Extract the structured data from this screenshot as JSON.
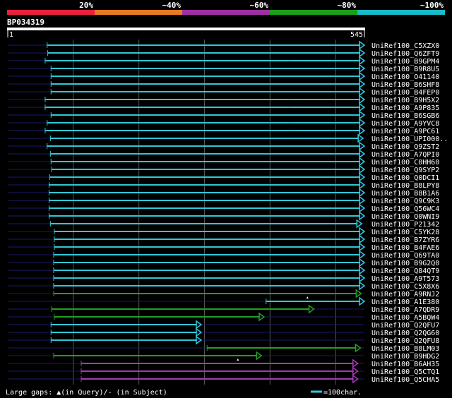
{
  "legend": {
    "labels": [
      "20%",
      "~40%",
      "~60%",
      "~80%",
      "~100%"
    ],
    "colors": [
      "#e8213c",
      "#e87a21",
      "#9e2fa3",
      "#18a018",
      "#18bcc8"
    ]
  },
  "query": {
    "id": "BP034319",
    "start_label": "1",
    "end_label": "545",
    "length": 545
  },
  "colors": {
    "background": "#000000",
    "grid": "#555555",
    "query_bar": "#ffffff",
    "query_line": "#1a1a6a"
  },
  "hits": [
    {
      "name": "UniRef100_C5XZX0",
      "start": 61,
      "end": 545,
      "color": "cyan",
      "arrow": true
    },
    {
      "name": "UniRef100_Q6ZFT9",
      "start": 62,
      "end": 545,
      "color": "cyan",
      "arrow": true
    },
    {
      "name": "UniRef100_B9GPM4",
      "start": 58,
      "end": 545,
      "color": "cyan",
      "arrow": true,
      "gap_tick": 430
    },
    {
      "name": "UniRef100_B9R8U5",
      "start": 67,
      "end": 545,
      "color": "cyan",
      "arrow": true
    },
    {
      "name": "UniRef100_O41140",
      "start": 67,
      "end": 545,
      "color": "cyan",
      "arrow": true
    },
    {
      "name": "UniRef100_B6SHF8",
      "start": 67,
      "end": 545,
      "color": "cyan",
      "arrow": true
    },
    {
      "name": "UniRef100_B4FEP0",
      "start": 67,
      "end": 545,
      "color": "cyan",
      "arrow": true
    },
    {
      "name": "UniRef100_B9H5X2",
      "start": 58,
      "end": 545,
      "color": "cyan",
      "arrow": true,
      "gap_tick": 430
    },
    {
      "name": "UniRef100_A9P835",
      "start": 58,
      "end": 545,
      "color": "cyan",
      "arrow": true,
      "gap_tick": 430
    },
    {
      "name": "UniRef100_B6SGB6",
      "start": 67,
      "end": 545,
      "color": "cyan",
      "arrow": true
    },
    {
      "name": "UniRef100_A9YVC8",
      "start": 61,
      "end": 545,
      "color": "cyan",
      "arrow": true,
      "gap_tick": 430
    },
    {
      "name": "UniRef100_A9PC61",
      "start": 58,
      "end": 545,
      "color": "cyan",
      "arrow": true,
      "gap_tick": 430
    },
    {
      "name": "UniRef100_UPI000..",
      "start": 66,
      "end": 543,
      "color": "cyan",
      "arrow": true
    },
    {
      "name": "UniRef100_Q9ZST2",
      "start": 61,
      "end": 545,
      "color": "cyan",
      "arrow": true
    },
    {
      "name": "UniRef100_A7QPI0",
      "start": 66,
      "end": 545,
      "color": "cyan",
      "arrow": true
    },
    {
      "name": "UniRef100_C0HH60",
      "start": 67,
      "end": 545,
      "color": "cyan",
      "arrow": true
    },
    {
      "name": "UniRef100_Q9SYP2",
      "start": 68,
      "end": 545,
      "color": "cyan",
      "arrow": true
    },
    {
      "name": "UniRef100_Q0DCI1",
      "start": 65,
      "end": 545,
      "color": "cyan",
      "arrow": true
    },
    {
      "name": "UniRef100_B8LPY8",
      "start": 64,
      "end": 545,
      "color": "cyan",
      "arrow": true
    },
    {
      "name": "UniRef100_B8B1A6",
      "start": 64,
      "end": 545,
      "color": "cyan",
      "arrow": true
    },
    {
      "name": "UniRef100_Q9C9K3",
      "start": 64,
      "end": 545,
      "color": "cyan",
      "arrow": true
    },
    {
      "name": "UniRef100_Q56WC4",
      "start": 64,
      "end": 545,
      "color": "cyan",
      "arrow": true
    },
    {
      "name": "UniRef100_Q0WNI9",
      "start": 64,
      "end": 545,
      "color": "cyan",
      "arrow": true
    },
    {
      "name": "UniRef100_P21342",
      "start": 66,
      "end": 541,
      "color": "cyan",
      "arrow": true
    },
    {
      "name": "UniRef100_C5YK28",
      "start": 72,
      "end": 545,
      "color": "cyan",
      "arrow": true
    },
    {
      "name": "UniRef100_B7ZYR6",
      "start": 72,
      "end": 545,
      "color": "cyan",
      "arrow": true
    },
    {
      "name": "UniRef100_B4FAE6",
      "start": 72,
      "end": 545,
      "color": "cyan",
      "arrow": true
    },
    {
      "name": "UniRef100_Q69TA0",
      "start": 71,
      "end": 545,
      "color": "cyan",
      "arrow": true
    },
    {
      "name": "UniRef100_B9G2Q0",
      "start": 71,
      "end": 545,
      "color": "cyan",
      "arrow": true
    },
    {
      "name": "UniRef100_Q84QT9",
      "start": 71,
      "end": 545,
      "color": "cyan",
      "arrow": true
    },
    {
      "name": "UniRef100_A9T573",
      "start": 71,
      "end": 545,
      "color": "cyan",
      "arrow": true
    },
    {
      "name": "UniRef100_C5X8X6",
      "start": 71,
      "end": 545,
      "color": "cyan",
      "arrow": true
    },
    {
      "name": "UniRef100_A9RNJ2",
      "start": 71,
      "end": 540,
      "color": "green",
      "arrow": true,
      "gap_mark": 458
    },
    {
      "name": "UniRef100_A1E380",
      "start": 395,
      "end": 545,
      "color": "cyan",
      "arrow": true
    },
    {
      "name": "UniRef100_A7QDR9",
      "start": 68,
      "end": 468,
      "color": "green",
      "arrow": true
    },
    {
      "name": "UniRef100_A5BQW4",
      "start": 72,
      "end": 392,
      "color": "green",
      "arrow": true
    },
    {
      "name": "UniRef100_Q2QFU7",
      "start": 67,
      "end": 296,
      "color": "cyan",
      "arrow": true
    },
    {
      "name": "UniRef100_Q2QG60",
      "start": 67,
      "end": 296,
      "color": "cyan",
      "arrow": true
    },
    {
      "name": "UniRef100_Q2QFU8",
      "start": 67,
      "end": 296,
      "color": "cyan",
      "arrow": true
    },
    {
      "name": "UniRef100_B8LM03",
      "start": 305,
      "end": 539,
      "color": "green",
      "arrow": true
    },
    {
      "name": "UniRef100_B9HDG2",
      "start": 71,
      "end": 388,
      "color": "green",
      "arrow": true,
      "gap_mark": 352
    },
    {
      "name": "UniRef100_B6AH35",
      "start": 113,
      "end": 535,
      "color": "purple",
      "arrow": true
    },
    {
      "name": "UniRef100_Q5CTQ1",
      "start": 113,
      "end": 535,
      "color": "purple",
      "arrow": true
    },
    {
      "name": "UniRef100_Q5CHA5",
      "start": 113,
      "end": 535,
      "color": "purple",
      "arrow": true
    }
  ],
  "hit_colors": {
    "cyan": "#2ec8d8",
    "green": "#20a020",
    "purple": "#a63ab0"
  },
  "footer": {
    "gaps_text": "Large gaps:",
    "gap_query_symbol": "▲",
    "gaps_query_text": "(in Query)/",
    "gap_subject_symbol": "-",
    "gaps_subject_text": " (in Subject)",
    "scale_text": "=100char."
  }
}
